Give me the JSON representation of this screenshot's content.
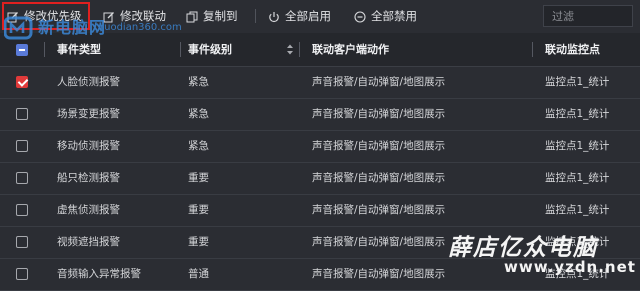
{
  "toolbar": {
    "buttons": [
      {
        "label": "修改优先级",
        "icon": "edit-icon",
        "highlighted": true
      },
      {
        "label": "修改联动",
        "icon": "edit-icon"
      },
      {
        "label": "复制到",
        "icon": "copy-icon"
      },
      {
        "label": "全部启用",
        "icon": "power-icon"
      },
      {
        "label": "全部禁用",
        "icon": "minus-circle-icon"
      }
    ],
    "filter_placeholder": "过滤"
  },
  "table": {
    "columns": [
      "事件类型",
      "事件级别",
      "联动客户端动作",
      "联动监控点"
    ],
    "rows": [
      {
        "checked": true,
        "type": "人脸侦测报警",
        "level": "紧急",
        "action": "声音报警/自动弹窗/地图展示",
        "point": "监控点1_统计"
      },
      {
        "checked": false,
        "type": "场景变更报警",
        "level": "紧急",
        "action": "声音报警/自动弹窗/地图展示",
        "point": "监控点1_统计"
      },
      {
        "checked": false,
        "type": "移动侦测报警",
        "level": "紧急",
        "action": "声音报警/自动弹窗/地图展示",
        "point": "监控点1_统计"
      },
      {
        "checked": false,
        "type": "船只检测报警",
        "level": "重要",
        "action": "声音报警/自动弹窗/地图展示",
        "point": "监控点1_统计"
      },
      {
        "checked": false,
        "type": "虚焦侦测报警",
        "level": "重要",
        "action": "声音报警/自动弹窗/地图展示",
        "point": "监控点1_统计"
      },
      {
        "checked": false,
        "type": "视频遮挡报警",
        "level": "重要",
        "action": "声音报警/自动弹窗/地图展示",
        "point": "监控点1_统计"
      },
      {
        "checked": false,
        "type": "音频输入异常报警",
        "level": "普通",
        "action": "声音报警/自动弹窗/地图展示",
        "point": "监控点1_统计"
      }
    ]
  },
  "watermarks": {
    "top_cn": "新电脑网",
    "top_url": "ruodian360.com",
    "bottom_cn": "薛店亿众电脑",
    "bottom_url": "www.yzdn.net"
  },
  "colors": {
    "background": "#2b2d33",
    "header_bg": "#25272c",
    "check_accent": "#e03a3a",
    "highlight_border": "#e02020"
  }
}
